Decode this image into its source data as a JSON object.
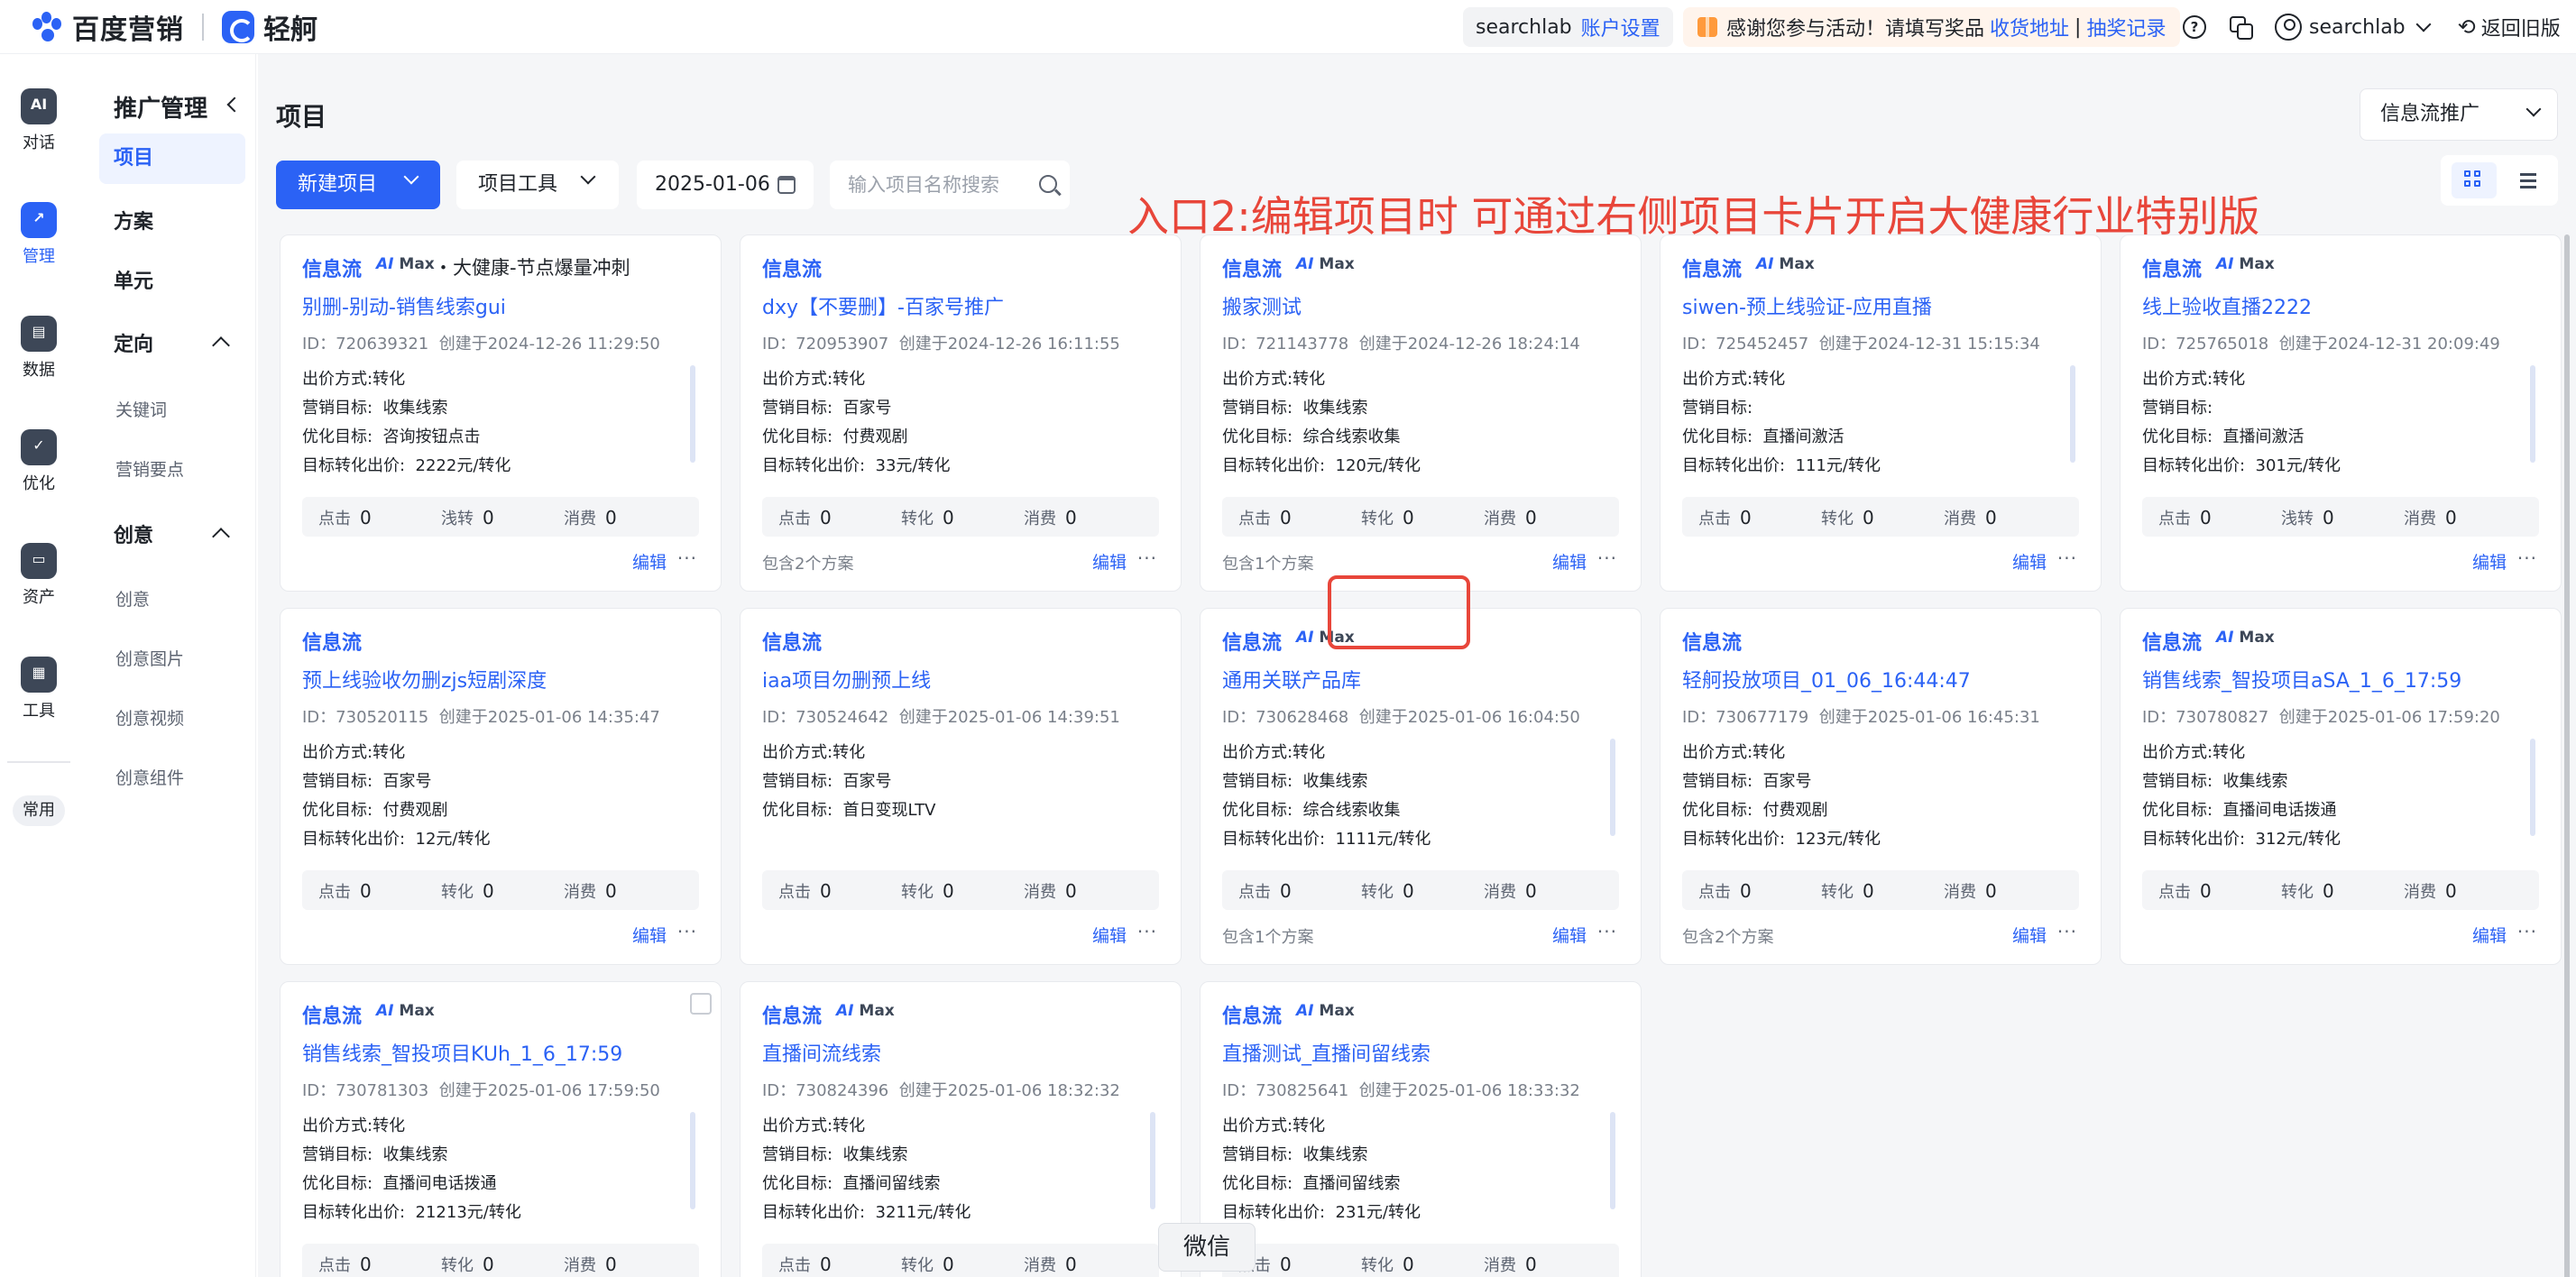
{
  "header": {
    "brand1": "百度营销",
    "brand2": "轻舸",
    "account_user": "searchlab",
    "account_settings": "账户设置",
    "notice_text": "感谢您参与活动！请填写奖品",
    "notice_link1": "收货地址",
    "notice_sep": "|",
    "notice_link2": "抽奖记录",
    "help_glyph": "?",
    "user_name": "searchlab",
    "back_old": "返回旧版"
  },
  "rail": [
    {
      "label": "对话",
      "icon": "ai-chat-icon",
      "glyph": "AI"
    },
    {
      "label": "管理",
      "icon": "trend-chart-icon",
      "glyph": "↗"
    },
    {
      "label": "数据",
      "icon": "data-icon",
      "glyph": "▤"
    },
    {
      "label": "优化",
      "icon": "shield-check-icon",
      "glyph": "✓"
    },
    {
      "label": "资产",
      "icon": "wallet-icon",
      "glyph": "▭"
    },
    {
      "label": "工具",
      "icon": "toolbox-icon",
      "glyph": "▦"
    }
  ],
  "rail_common": "常用",
  "nav": {
    "title": "推广管理",
    "items": {
      "project": "项目",
      "plan": "方案",
      "unit": "单元",
      "targeting": "定向",
      "keywords": "关键词",
      "selling_points": "营销要点",
      "creative": "创意",
      "creative_sub": "创意",
      "creative_image": "创意图片",
      "creative_video": "创意视频",
      "creative_component": "创意组件"
    }
  },
  "main": {
    "title": "项目",
    "flow_select": "信息流推广",
    "new_project": "新建项目",
    "project_tools": "项目工具",
    "date": "2025-01-06",
    "search_placeholder": "输入项目名称搜索",
    "annotation": "入口2:编辑项目时 可通过右侧项目卡片开启大健康行业特别版",
    "tooltip": "微信"
  },
  "labels": {
    "bid_method": "出价方式:",
    "marketing_goal": "营销目标:",
    "optimize_goal": "优化目标:",
    "target_bid": "目标转化出价:",
    "clicks": "点击",
    "shallow": "浅转",
    "convert": "转化",
    "spend": "消费",
    "edit": "编辑",
    "more": "···",
    "tag": "信息流",
    "max_ai": "AI",
    "max": "Max"
  },
  "cards": [
    {
      "max": true,
      "sub": "・大健康-节点爆量冲刺",
      "name": "别删-别动-销售线索gui",
      "id": "ID：720639321",
      "created": "创建于2024-12-26 11:29:50",
      "bid": "转化",
      "goal": "收集线索",
      "opt": "咨询按钮点击",
      "price": "2222元/转化",
      "s1": "点击",
      "v1": "0",
      "s2": "浅转",
      "v2": "0",
      "v3": "0",
      "plans": "",
      "scroll": true
    },
    {
      "max": false,
      "sub": "",
      "name": "dxy【不要删】-百家号推广",
      "id": "ID：720953907",
      "created": "创建于2024-12-26 16:11:55",
      "bid": "转化",
      "goal": "百家号",
      "opt": "付费观剧",
      "price": "33元/转化",
      "s1": "点击",
      "v1": "0",
      "s2": "转化",
      "v2": "0",
      "v3": "0",
      "plans": "包含2个方案",
      "scroll": false
    },
    {
      "max": true,
      "sub": "",
      "name": "搬家测试",
      "id": "ID：721143778",
      "created": "创建于2024-12-26 18:24:14",
      "bid": "转化",
      "goal": "收集线索",
      "opt": "综合线索收集",
      "price": "120元/转化",
      "s1": "点击",
      "v1": "0",
      "s2": "转化",
      "v2": "0",
      "v3": "0",
      "plans": "包含1个方案",
      "scroll": false
    },
    {
      "max": true,
      "sub": "",
      "name": "siwen-预上线验证-应用直播",
      "id": "ID：725452457",
      "created": "创建于2024-12-31 15:15:34",
      "bid": "转化",
      "goal": "",
      "opt": "直播间激活",
      "price": "111元/转化",
      "s1": "点击",
      "v1": "0",
      "s2": "转化",
      "v2": "0",
      "v3": "0",
      "plans": "",
      "scroll": true
    },
    {
      "max": true,
      "sub": "",
      "name": "线上验收直播2222",
      "id": "ID：725765018",
      "created": "创建于2024-12-31 20:09:49",
      "bid": "转化",
      "goal": "",
      "opt": "直播间激活",
      "price": "301元/转化",
      "s1": "点击",
      "v1": "0",
      "s2": "浅转",
      "v2": "0",
      "v3": "0",
      "plans": "",
      "scroll": true
    },
    {
      "max": false,
      "sub": "",
      "name": "预上线验收勿删zjs短剧深度",
      "id": "ID：730520115",
      "created": "创建于2025-01-06 14:35:47",
      "bid": "转化",
      "goal": "百家号",
      "opt": "付费观剧",
      "price": "12元/转化",
      "s1": "点击",
      "v1": "0",
      "s2": "转化",
      "v2": "0",
      "v3": "0",
      "plans": "",
      "scroll": false
    },
    {
      "max": false,
      "sub": "",
      "name": "iaa项目勿删预上线",
      "id": "ID：730524642",
      "created": "创建于2025-01-06 14:39:51",
      "bid": "转化",
      "goal": "百家号",
      "opt": "首日变现LTV",
      "price": "",
      "s1": "点击",
      "v1": "0",
      "s2": "转化",
      "v2": "0",
      "v3": "0",
      "plans": "",
      "scroll": false
    },
    {
      "max": true,
      "sub": "",
      "name": "通用关联产品库",
      "id": "ID：730628468",
      "created": "创建于2025-01-06 16:04:50",
      "bid": "转化",
      "goal": "收集线索",
      "opt": "综合线索收集",
      "price": "1111元/转化",
      "s1": "点击",
      "v1": "0",
      "s2": "转化",
      "v2": "0",
      "v3": "0",
      "plans": "包含1个方案",
      "scroll": true
    },
    {
      "max": false,
      "sub": "",
      "name": "轻舸投放项目_01_06_16:44:47",
      "id": "ID：730677179",
      "created": "创建于2025-01-06 16:45:31",
      "bid": "转化",
      "goal": "百家号",
      "opt": "付费观剧",
      "price": "123元/转化",
      "s1": "点击",
      "v1": "0",
      "s2": "转化",
      "v2": "0",
      "v3": "0",
      "plans": "包含2个方案",
      "scroll": false
    },
    {
      "max": true,
      "sub": "",
      "name": "销售线索_智投项目aSA_1_6_17:59",
      "id": "ID：730780827",
      "created": "创建于2025-01-06 17:59:20",
      "bid": "转化",
      "goal": "收集线索",
      "opt": "直播间电话拨通",
      "price": "312元/转化",
      "s1": "点击",
      "v1": "0",
      "s2": "转化",
      "v2": "0",
      "v3": "0",
      "plans": "",
      "scroll": true
    },
    {
      "max": true,
      "sub": "",
      "name": "销售线索_智投项目KUh_1_6_17:59",
      "id": "ID：730781303",
      "created": "创建于2025-01-06 17:59:50",
      "bid": "转化",
      "goal": "收集线索",
      "opt": "直播间电话拨通",
      "price": "21213元/转化",
      "s1": "点击",
      "v1": "0",
      "s2": "转化",
      "v2": "0",
      "v3": "0",
      "plans": "",
      "scroll": true,
      "checkbox": true
    },
    {
      "max": true,
      "sub": "",
      "name": "直播间流线索",
      "id": "ID：730824396",
      "created": "创建于2025-01-06 18:32:32",
      "bid": "转化",
      "goal": "收集线索",
      "opt": "直播间留线索",
      "price": "3211元/转化",
      "s1": "点击",
      "v1": "0",
      "s2": "转化",
      "v2": "0",
      "v3": "0",
      "plans": "",
      "scroll": true
    },
    {
      "max": true,
      "sub": "",
      "name": "直播测试_直播间留线索",
      "id": "ID：730825641",
      "created": "创建于2025-01-06 18:33:32",
      "bid": "转化",
      "goal": "收集线索",
      "opt": "直播间留线索",
      "price": "231元/转化",
      "s1": "点击",
      "v1": "0",
      "s2": "转化",
      "v2": "0",
      "v3": "0",
      "plans": "",
      "scroll": true
    }
  ],
  "colors": {
    "accent": "#2b62f5",
    "annotation_red": "#e8463a",
    "background": "#f5f6f8"
  }
}
